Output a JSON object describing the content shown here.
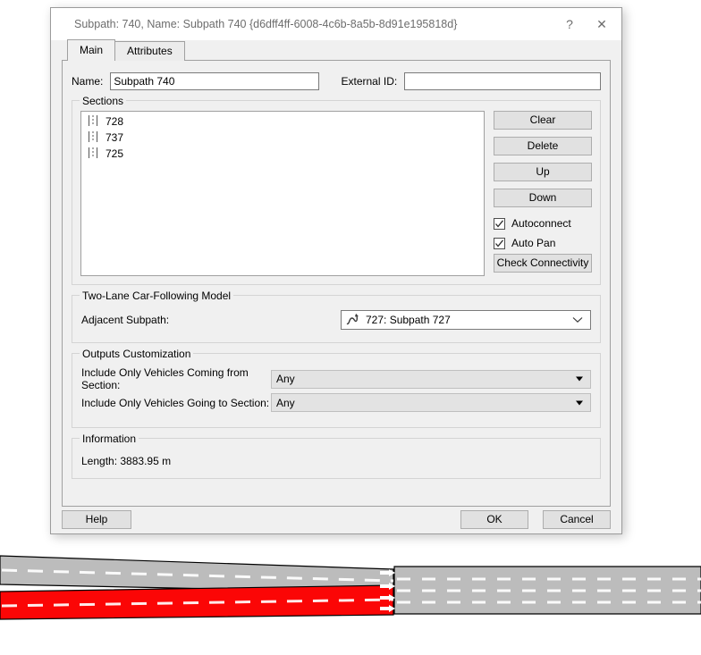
{
  "window": {
    "title": "Subpath: 740, Name: Subpath 740  {d6dff4ff-6008-4c6b-8a5b-8d91e195818d}",
    "help_caption": "?",
    "close_caption": "✕"
  },
  "tabs": [
    {
      "label": "Main",
      "selected": true
    },
    {
      "label": "Attributes",
      "selected": false
    }
  ],
  "main": {
    "name_label": "Name:",
    "name_value": "Subpath 740",
    "name_placeholder": "",
    "external_id_label": "External ID:",
    "external_id_value": "",
    "external_id_placeholder": ""
  },
  "sections": {
    "group_title": "Sections",
    "items": [
      {
        "icon": "road-section-icon",
        "label": "728"
      },
      {
        "icon": "road-section-icon",
        "label": "737"
      },
      {
        "icon": "road-section-icon",
        "label": "725"
      }
    ],
    "buttons": {
      "clear": "Clear",
      "delete": "Delete",
      "up": "Up",
      "down": "Down",
      "check_connectivity": "Check Connectivity"
    },
    "checkboxes": [
      {
        "label": "Autoconnect",
        "checked": true
      },
      {
        "label": "Auto Pan",
        "checked": true
      }
    ]
  },
  "two_lane": {
    "group_title": "Two-Lane Car-Following Model",
    "adjacent_label": "Adjacent Subpath:",
    "adjacent_value": "727: Subpath 727",
    "adjacent_icon": "subpath-curve-icon"
  },
  "outputs": {
    "group_title": "Outputs Customization",
    "rows": [
      {
        "label": "Include Only Vehicles Coming from Section:",
        "value": "Any"
      },
      {
        "label": "Include Only Vehicles Going to Section:",
        "value": "Any"
      }
    ]
  },
  "information": {
    "group_title": "Information",
    "length_text": "Length: 3883.95 m"
  },
  "footer": {
    "help": "Help",
    "ok": "OK",
    "cancel": "Cancel"
  },
  "colors": {
    "dialog_background": "#f0f0f0",
    "selected_section": "#fb0606",
    "road_fill": "#bcbcbc",
    "lane_marking": "#ffffff",
    "road_outline": "#000000"
  }
}
